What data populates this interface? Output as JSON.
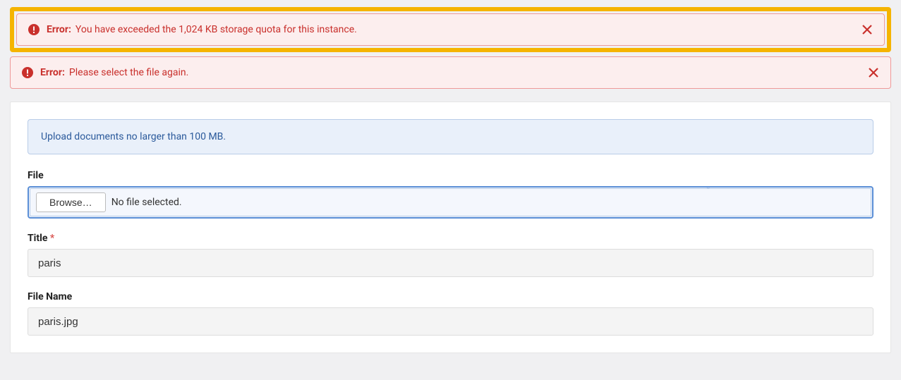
{
  "alerts": {
    "quota": {
      "label": "Error:",
      "message": "You have exceeded the 1,024 KB storage quota for this instance."
    },
    "reselect": {
      "label": "Error:",
      "message": "Please select the file again."
    }
  },
  "info_banner": "Upload documents no larger than 100 MB.",
  "form": {
    "file": {
      "label": "File",
      "browse_label": "Browse…",
      "status": "No file selected."
    },
    "title": {
      "label": "Title",
      "required_mark": "*",
      "value": "paris"
    },
    "filename": {
      "label": "File Name",
      "value": "paris.jpg"
    }
  }
}
